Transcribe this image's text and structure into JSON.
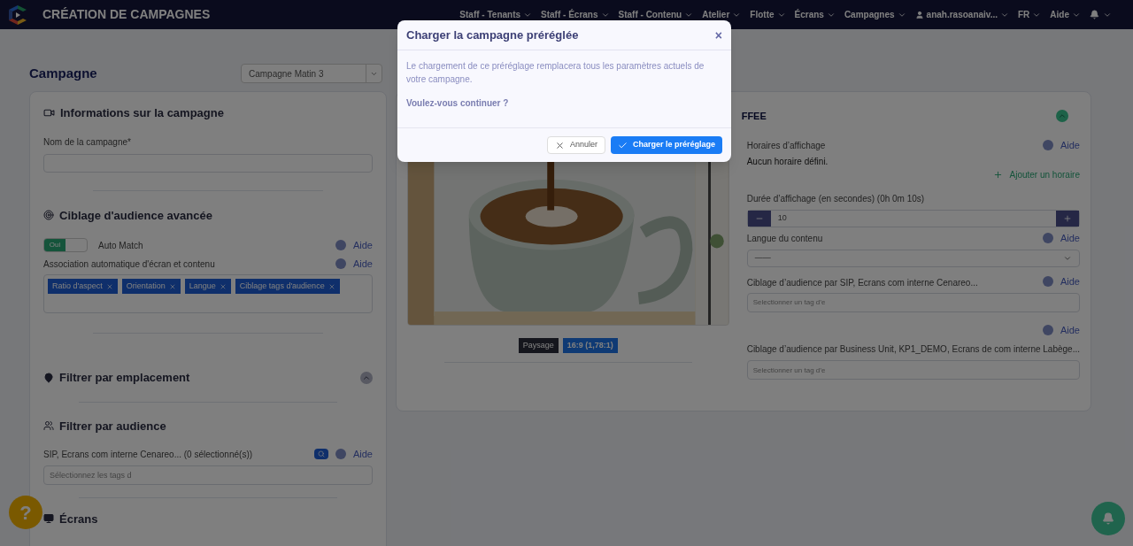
{
  "navbar": {
    "title": "CRÉATION DE CAMPAGNES",
    "menu": [
      {
        "label": "Staff - Tenants",
        "kind": "menu"
      },
      {
        "label": "Staff - Écrans",
        "kind": "menu"
      },
      {
        "label": "Staff - Contenu",
        "kind": "menu"
      },
      {
        "label": "Atelier",
        "kind": "menu"
      },
      {
        "label": "Flotte",
        "kind": "menu"
      },
      {
        "label": "Écrans",
        "kind": "menu"
      },
      {
        "label": "Campagnes",
        "kind": "menu"
      },
      {
        "label": "anah.rasoanaiv...",
        "kind": "user"
      },
      {
        "label": "FR",
        "kind": "menu"
      },
      {
        "label": "Aide",
        "kind": "menu"
      },
      {
        "kind": "bell"
      }
    ]
  },
  "campaign": {
    "heading": "Campagne",
    "preset_select": {
      "value": "Campagne Matin 3"
    }
  },
  "left_card": {
    "info": {
      "title": "Informations sur la campagne",
      "name_label": "Nom de la campagne*"
    },
    "targeting": {
      "title": "Ciblage d'audience avancée",
      "toggle": {
        "label": "Oui",
        "on": true
      },
      "toggle_label": "Auto Match",
      "toggle_help": "Aide",
      "association_label": "Association automatique d'écran et contenu",
      "association_help": "Aide",
      "tags": [
        {
          "label": "Ratio d'aspect"
        },
        {
          "label": "Orientation"
        },
        {
          "label": "Langue"
        },
        {
          "label": "Ciblage tags d'audience"
        }
      ]
    },
    "location": {
      "title": "Filtrer par emplacement"
    },
    "audience": {
      "title": "Filtrer par audience",
      "label": "SIP, Ecrans com interne Cenareo... (0 sélectionné(s))",
      "help": "Aide",
      "placeholder": "Sélectionnez les tags d"
    },
    "screens": {
      "title": "Écrans"
    }
  },
  "right_card": {
    "title": "FFEE",
    "badges": [
      {
        "label": "Paysage",
        "kind": "dark"
      },
      {
        "label": "16:9 (1,78:1)",
        "kind": "blue"
      }
    ],
    "schedule": {
      "label": "Horaires d’affichage",
      "help": "Aide",
      "empty": "Aucun horaire défini.",
      "add": "Ajouter un horaire"
    },
    "duration": {
      "label": "Durée d’affichage (en secondes) (0h 0m 10s)",
      "value": "10"
    },
    "language": {
      "label": "Langue du contenu",
      "help": "Aide",
      "value": "——"
    },
    "sip": {
      "label": "Ciblage d’audience par SIP, Ecrans com interne Cenareo...",
      "help": "Aide",
      "placeholder": "Selectionner un tag d’e"
    },
    "business_unit": {
      "help": "Aide",
      "label": "Ciblage d’audience par Business Unit, KP1_DEMO, Ecrans de com interne Labège...",
      "placeholder": "Selectionner un tag d’e"
    }
  },
  "help_button": {
    "label": "?"
  },
  "modal": {
    "title": "Charger la campagne préréglée",
    "close": "×",
    "message": "Le chargement de ce préréglage remplacera tous les paramètres actuels de votre campagne.",
    "question": "Voulez-vous continuer ?",
    "buttons": [
      {
        "label": "Annuler",
        "kind": "cancel"
      },
      {
        "label": "Charger le préréglage",
        "kind": "confirm"
      }
    ]
  }
}
